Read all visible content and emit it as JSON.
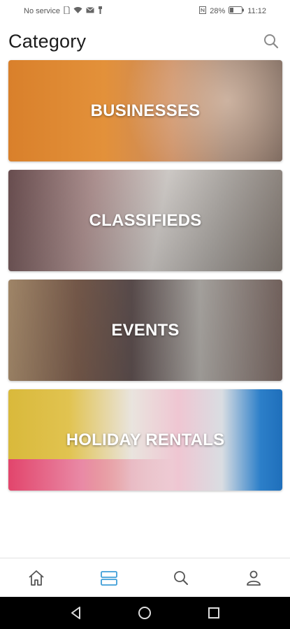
{
  "status_bar": {
    "carrier": "No service",
    "battery": "28%",
    "time": "11:12",
    "icons": [
      "sim-icon",
      "wifi-icon",
      "mail-icon",
      "usb-icon",
      "nfc-icon",
      "battery-icon"
    ]
  },
  "header": {
    "title": "Category",
    "search_icon": "search-icon"
  },
  "categories": [
    {
      "label": "BUSINESSES"
    },
    {
      "label": "CLASSIFIEDS"
    },
    {
      "label": "EVENTS"
    },
    {
      "label": "HOLIDAY RENTALS"
    }
  ],
  "bottom_nav": {
    "items": [
      "home-icon",
      "categories-icon",
      "search-icon",
      "profile-icon"
    ],
    "active_color": "#3e9ed8",
    "inactive_color": "#555555"
  },
  "system_nav": [
    "back-icon",
    "home-circle-icon",
    "recents-icon"
  ]
}
